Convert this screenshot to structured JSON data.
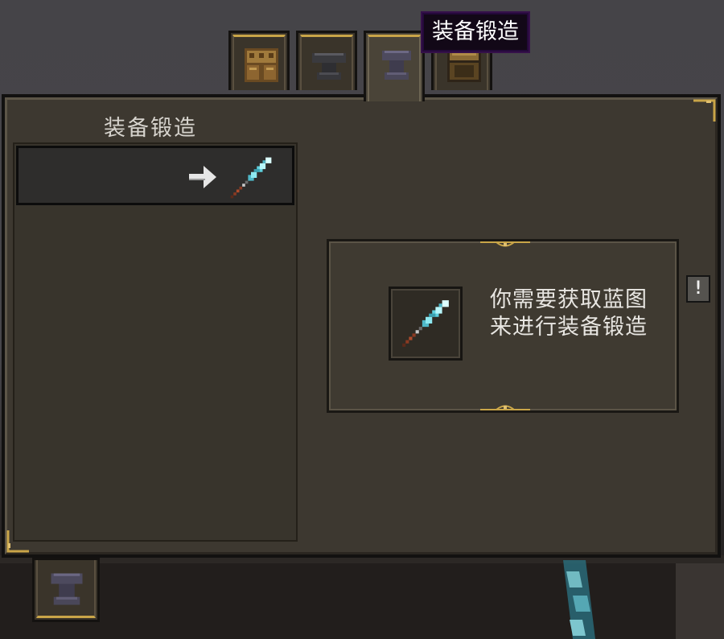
{
  "tooltip": {
    "text": "装备锻造"
  },
  "tabs": [
    {
      "name": "crafting",
      "icon": "crafting-table-icon"
    },
    {
      "name": "anvil",
      "icon": "anvil-icon"
    },
    {
      "name": "smithing",
      "icon": "smithing-anvil-icon",
      "active": true
    },
    {
      "name": "loom",
      "icon": "storage-block-icon"
    }
  ],
  "panel": {
    "title": "装备锻造",
    "recipe_list": [
      {
        "output_icon": "diamond-spear-icon",
        "arrow_icon": "arrow-right-icon"
      }
    ],
    "info": {
      "slot_icon": "diamond-spear-icon",
      "message": "你需要获取蓝图来进行装备锻造"
    },
    "alert_button": {
      "label": "!"
    }
  },
  "bottom_tab": {
    "icon": "smithing-anvil-icon"
  },
  "colors": {
    "panel_bg": "#3d3830",
    "gold_trim": "#c9a548",
    "tooltip_bg": "#120817",
    "tooltip_border": "#35104a"
  }
}
